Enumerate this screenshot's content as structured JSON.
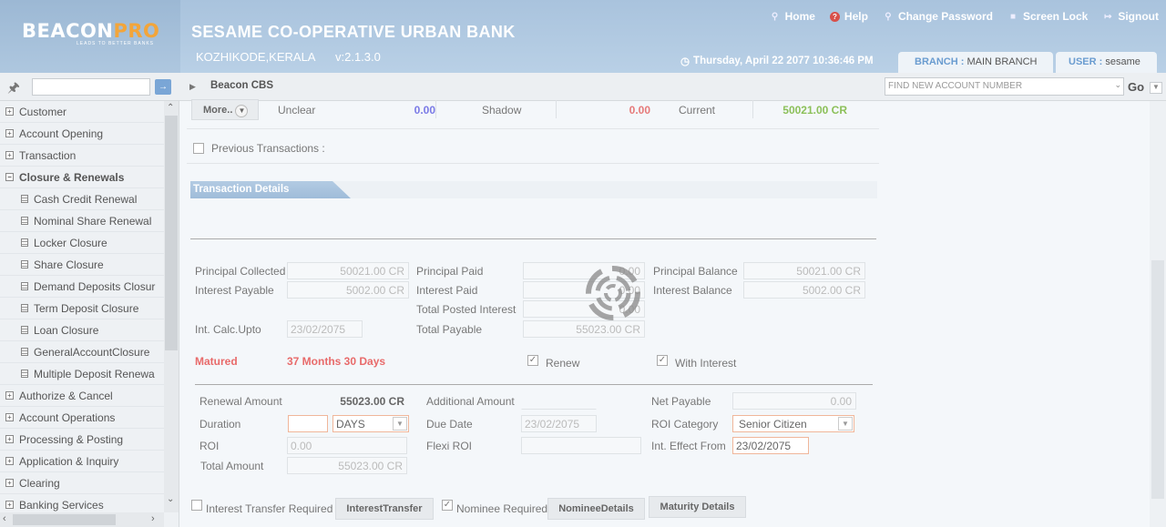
{
  "header": {
    "logo_main": "BEACON",
    "logo_pro": "PRO",
    "logo_tagline": "LEADS TO BETTER BANKS",
    "bank_name": "SESAME CO-OPERATIVE URBAN BANK",
    "location": "KOZHIKODE,KERALA",
    "version": "v:2.1.3.0",
    "links": [
      "Home",
      "Help",
      "Change Password",
      "Screen Lock",
      "Signout"
    ],
    "datetime": "Thursday, April 22 2077 10:36:46 PM",
    "branch_label": "BRANCH :",
    "branch_value": "MAIN BRANCH",
    "user_label": "USER :",
    "user_value": "sesame"
  },
  "toolbar": {
    "breadcrumb": "Beacon CBS",
    "account_placeholder": "FIND NEW ACCOUNT NUMBER",
    "go_label": "Go"
  },
  "sidebar": {
    "items": [
      {
        "label": "Customer",
        "type": "group"
      },
      {
        "label": "Account Opening",
        "type": "group"
      },
      {
        "label": "Transaction",
        "type": "group"
      },
      {
        "label": "Closure & Renewals",
        "type": "group-open"
      },
      {
        "label": "Cash Credit Renewal",
        "type": "sub"
      },
      {
        "label": "Nominal Share Renewal",
        "type": "sub"
      },
      {
        "label": "Locker Closure",
        "type": "sub"
      },
      {
        "label": "Share Closure",
        "type": "sub"
      },
      {
        "label": "Demand Deposits Closur",
        "type": "sub"
      },
      {
        "label": "Term Deposit Closure",
        "type": "sub"
      },
      {
        "label": "Loan Closure",
        "type": "sub"
      },
      {
        "label": "GeneralAccountClosure",
        "type": "sub"
      },
      {
        "label": "Multiple Deposit Renewa",
        "type": "sub"
      },
      {
        "label": "Authorize & Cancel",
        "type": "group"
      },
      {
        "label": "Account Operations",
        "type": "group"
      },
      {
        "label": "Processing & Posting",
        "type": "group"
      },
      {
        "label": "Application & Inquiry",
        "type": "group"
      },
      {
        "label": "Clearing",
        "type": "group"
      },
      {
        "label": "Banking Services",
        "type": "group"
      }
    ]
  },
  "balances": {
    "more_label": "More..",
    "unclear_label": "Unclear",
    "unclear_value": "0.00",
    "shadow_label": "Shadow",
    "shadow_value": "0.00",
    "current_label": "Current",
    "current_value": "50021.00 CR",
    "colors": {
      "unclear": "#7a7ae6",
      "shadow": "#e67a7a",
      "current": "#8cc05a"
    }
  },
  "previous_transactions_label": "Previous Transactions :",
  "section_title": "Transaction Details",
  "details": {
    "principal_collected_label": "Principal Collected",
    "principal_collected": "50021.00 CR",
    "interest_payable_label": "Interest Payable",
    "interest_payable": "5002.00 CR",
    "int_calc_upto_label": "Int. Calc.Upto",
    "int_calc_upto": "23/02/2075",
    "principal_paid_label": "Principal Paid",
    "principal_paid": "0.00",
    "interest_paid_label": "Interest Paid",
    "interest_paid": "0.00",
    "total_posted_interest_label": "Total Posted Interest",
    "total_posted_interest": "0.00",
    "total_payable_label": "Total Payable",
    "total_payable": "55023.00 CR",
    "principal_balance_label": "Principal Balance",
    "principal_balance": "50021.00 CR",
    "interest_balance_label": "Interest Balance",
    "interest_balance": "5002.00 CR",
    "matured_label": "Matured",
    "matured_value": "37 Months 30 Days",
    "renew_label": "Renew",
    "with_interest_label": "With Interest"
  },
  "renewal": {
    "renewal_amount_label": "Renewal Amount",
    "renewal_amount": "55023.00 CR",
    "duration_label": "Duration",
    "duration_value": "",
    "duration_unit": "DAYS",
    "roi_label": "ROI",
    "roi_value": "0.00",
    "total_amount_label": "Total Amount",
    "total_amount": "55023.00 CR",
    "additional_amount_label": "Additional Amount",
    "additional_amount": "",
    "due_date_label": "Due Date",
    "due_date": "23/02/2075",
    "flexi_roi_label": "Flexi ROI",
    "flexi_roi": "",
    "net_payable_label": "Net Payable",
    "net_payable": "0.00",
    "roi_category_label": "ROI Category",
    "roi_category": "Senior Citizen",
    "int_effect_from_label": "Int. Effect From",
    "int_effect_from": "23/02/2075"
  },
  "footer": {
    "interest_transfer_required_label": "Interest Transfer Required",
    "interest_transfer_button": "InterestTransfer",
    "nominee_required_label": "Nominee Required",
    "nominee_details_button": "NomineeDetails",
    "maturity_details_button": "Maturity Details"
  }
}
